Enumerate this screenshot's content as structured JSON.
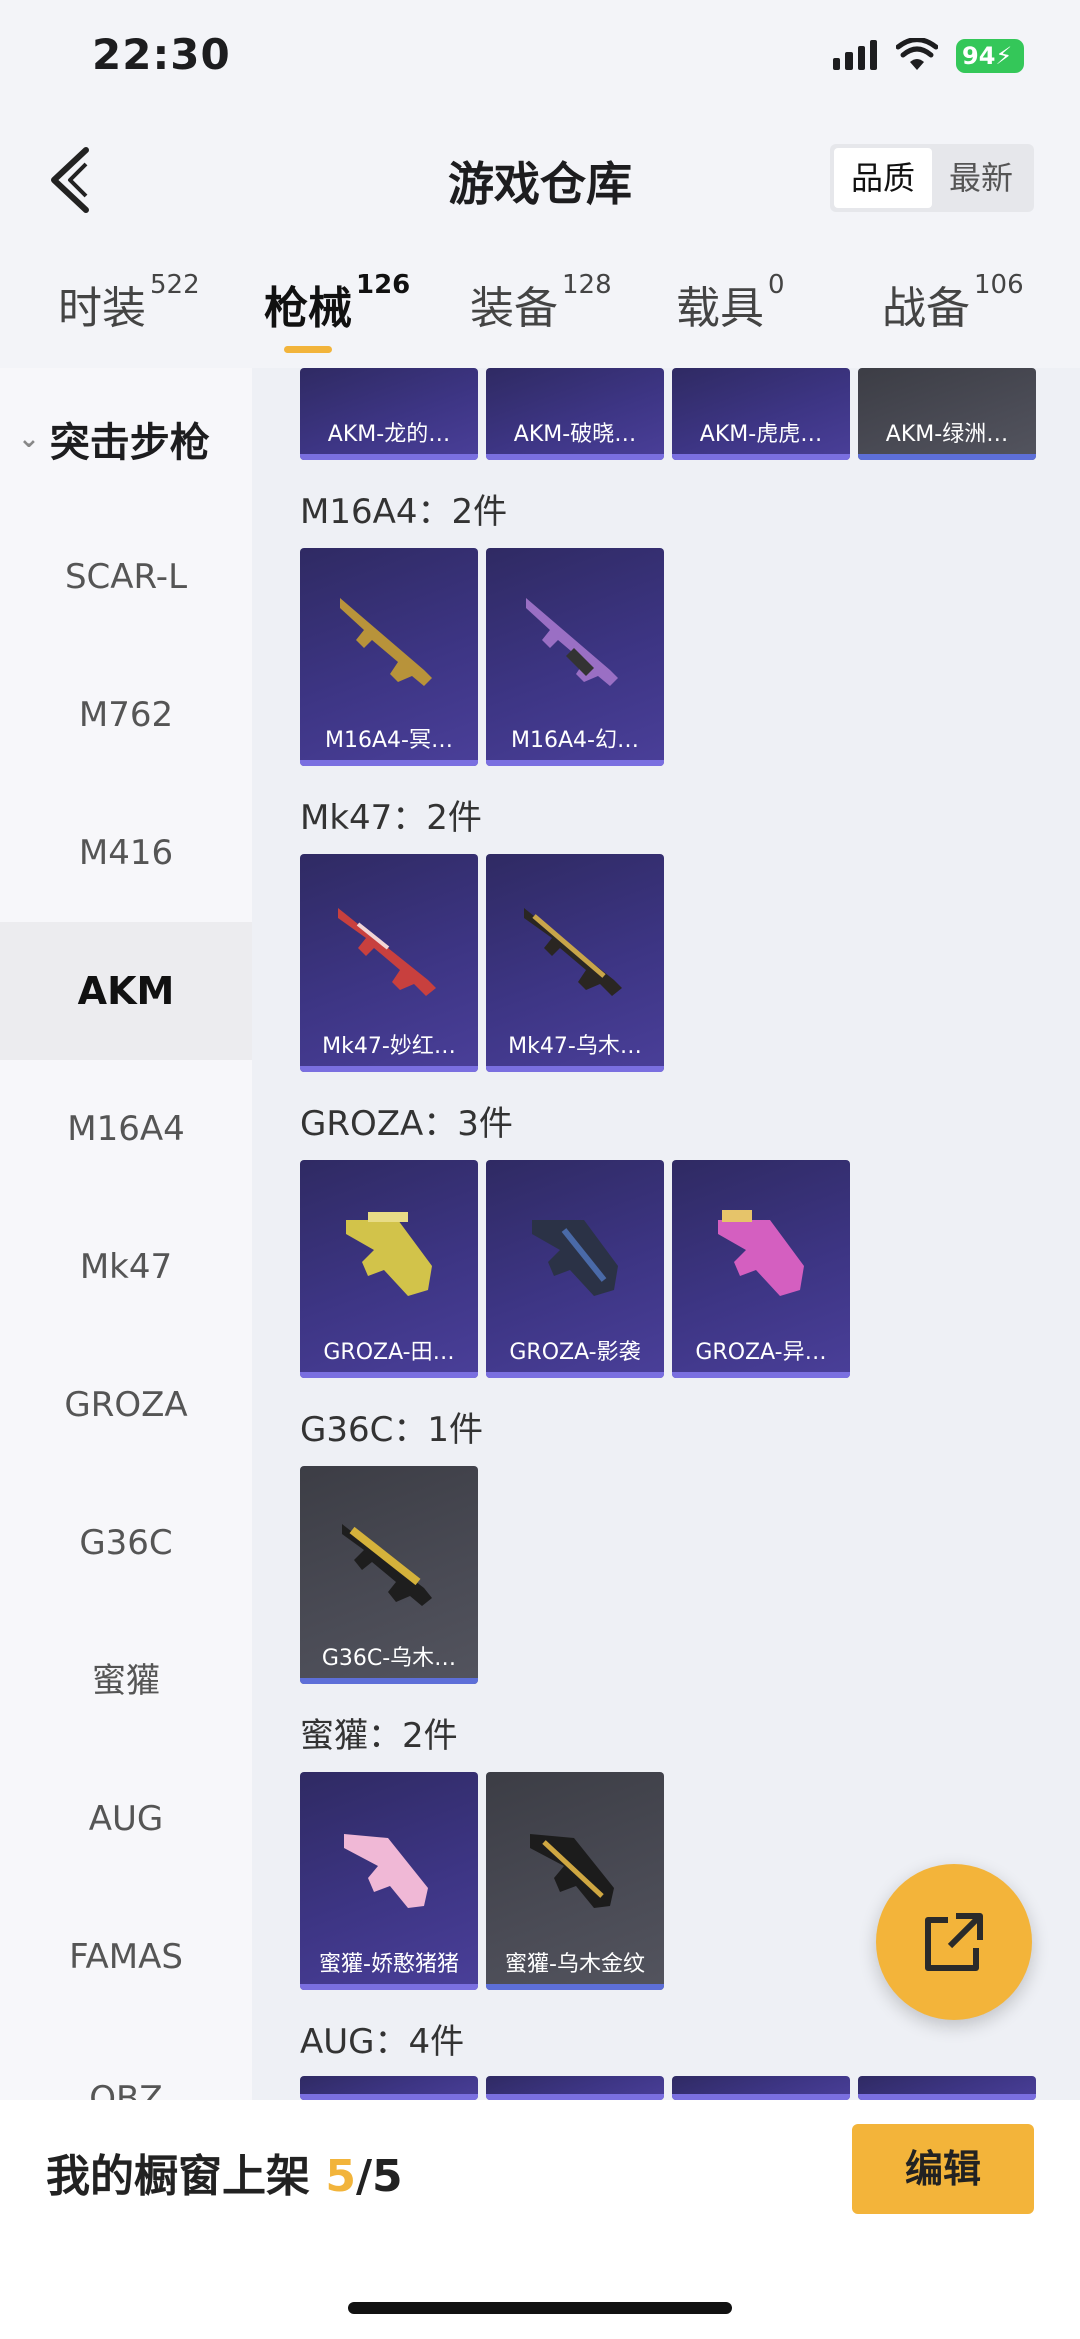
{
  "status": {
    "time": "22:30",
    "battery": "94"
  },
  "header": {
    "title": "游戏仓库",
    "sort_quality": "品质",
    "sort_newest": "最新"
  },
  "tabs": [
    {
      "label": "时装",
      "count": "522"
    },
    {
      "label": "枪械",
      "count": "126"
    },
    {
      "label": "装备",
      "count": "128"
    },
    {
      "label": "载具",
      "count": "0"
    },
    {
      "label": "战备",
      "count": "106"
    }
  ],
  "sidebar": {
    "group": "突击步枪",
    "items": [
      "SCAR-L",
      "M762",
      "M416",
      "AKM",
      "M16A4",
      "Mk47",
      "GROZA",
      "G36C",
      "蜜獾",
      "AUG",
      "FAMAS",
      "QBZ"
    ]
  },
  "sections": [
    {
      "title": "",
      "items": [
        "AKM-龙的…",
        "AKM-破晓…",
        "AKM-虎虎…",
        "AKM-绿洲…"
      ]
    },
    {
      "title": "M16A4：2件",
      "items": [
        "M16A4-冥…",
        "M16A4-幻…"
      ]
    },
    {
      "title": "Mk47：2件",
      "items": [
        "Mk47-妙红…",
        "Mk47-乌木…"
      ]
    },
    {
      "title": "GROZA：3件",
      "items": [
        "GROZA-田…",
        "GROZA-影袭",
        "GROZA-异…"
      ]
    },
    {
      "title": "G36C：1件",
      "items": [
        "G36C-乌木…"
      ]
    },
    {
      "title": "蜜獾：2件",
      "items": [
        "蜜獾-娇憨猪猪",
        "蜜獾-乌木金纹"
      ]
    },
    {
      "title": "AUG：4件",
      "items": []
    }
  ],
  "bottom": {
    "showcase_prefix": "我的橱窗上架 ",
    "showcase_count": "5",
    "showcase_total": "/5",
    "edit_label": "编辑"
  },
  "colors": {
    "accent": "#f3b43a",
    "card_purple": "#3d3584",
    "card_grey": "#4a4b55"
  }
}
